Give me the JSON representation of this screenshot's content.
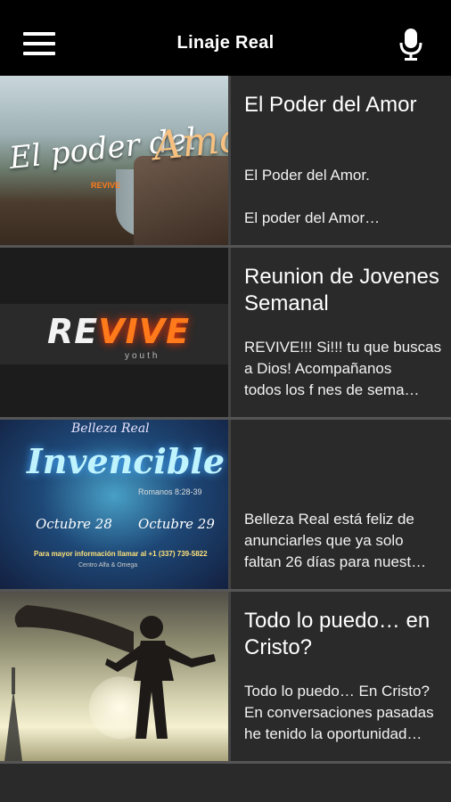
{
  "appbar": {
    "title": "Linaje Real",
    "menu_icon": "hamburger-menu-icon",
    "mic_icon": "microphone-icon"
  },
  "posts": [
    {
      "title": "El Poder del Amor",
      "desc_line1": "El Poder del Amor.",
      "desc_line2": "",
      "desc_line3": "El poder del Amor…",
      "thumb": {
        "script_a": "El poder del",
        "script_b": "Amor",
        "tag": "REVIVE"
      }
    },
    {
      "title": "Reunion de Jovenes Semanal",
      "desc_line1": "REVIVE!!! Si!!! tu que buscas",
      "desc_line2": "a Dios! Acompañanos",
      "desc_line3": "todos los f nes de sema…",
      "thumb": {
        "word_a": "RE",
        "word_b": "VIVE",
        "sub": "youth"
      }
    },
    {
      "title": "",
      "desc_line1": "Belleza Real está feliz de",
      "desc_line2": "anunciarles que ya solo",
      "desc_line3": "faltan 26 días para nuest…",
      "thumb": {
        "brand": "Belleza Real",
        "headline": "Invencible",
        "verse": "Romanos 8:28-39",
        "date1": "Octubre 28",
        "date2": "Octubre 29",
        "info": "Para mayor información llamar al +1 (337) 739-5822",
        "place": "Centro Alfa & Omega"
      }
    },
    {
      "title": "Todo lo puedo… en Cristo?",
      "desc_line1": "Todo lo puedo… En Cristo?",
      "desc_line2": "En conversaciones pasadas",
      "desc_line3": "he tenido la oportunidad…",
      "thumb": {}
    }
  ]
}
